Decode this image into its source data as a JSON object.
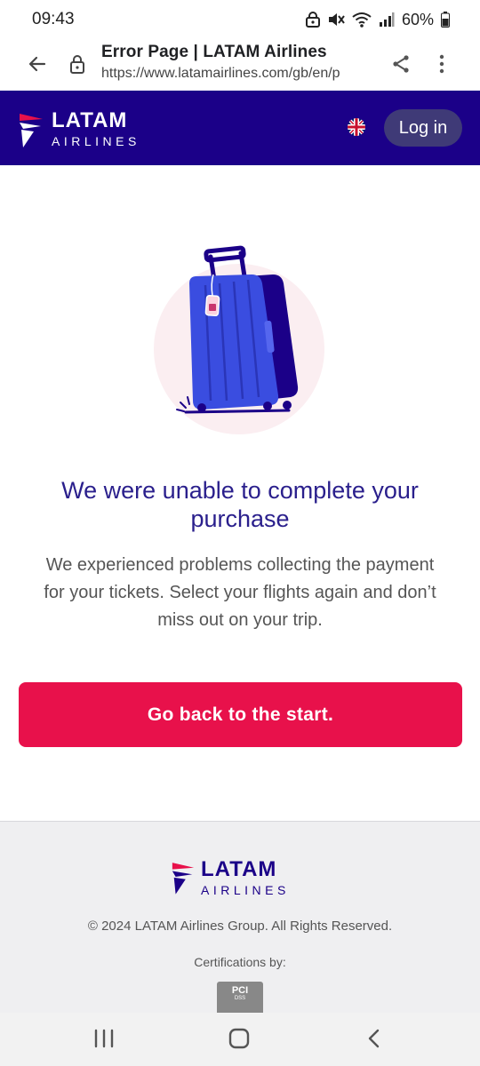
{
  "status_bar": {
    "time": "09:43",
    "battery_percent": "60%",
    "icons": [
      "vpn-icon",
      "mute-icon",
      "wifi-icon",
      "signal-icon",
      "battery-icon"
    ]
  },
  "browser": {
    "page_title": "Error Page | LATAM Airlines",
    "url": "https://www.latamairlines.com/gb/en/p",
    "icons": [
      "back-arrow-icon",
      "lock-icon",
      "share-icon",
      "more-vert-icon"
    ]
  },
  "header": {
    "logo_line1": "LATAM",
    "logo_line2": "AIRLINES",
    "language_flag": "uk-flag-icon",
    "login_label": "Log in",
    "background_color": "#1b0088"
  },
  "main": {
    "illustration": "suitcase-illustration",
    "title": "We were unable to complete your purchase",
    "description": "We experienced problems collecting the payment for your tickets. Select your flights again and don’t miss out on your trip.",
    "cta_label": "Go back to the start.",
    "cta_color": "#e8114b"
  },
  "footer": {
    "logo_line1": "LATAM",
    "logo_line2": "AIRLINES",
    "copyright": "© 2024 LATAM Airlines Group. All Rights Reserved.",
    "certifications_label": "Certifications by:",
    "badge_text": "PCI",
    "badge_subtext": "DSS"
  },
  "nav_bar": {
    "icons": [
      "recents-icon",
      "home-icon",
      "nav-back-icon"
    ]
  }
}
